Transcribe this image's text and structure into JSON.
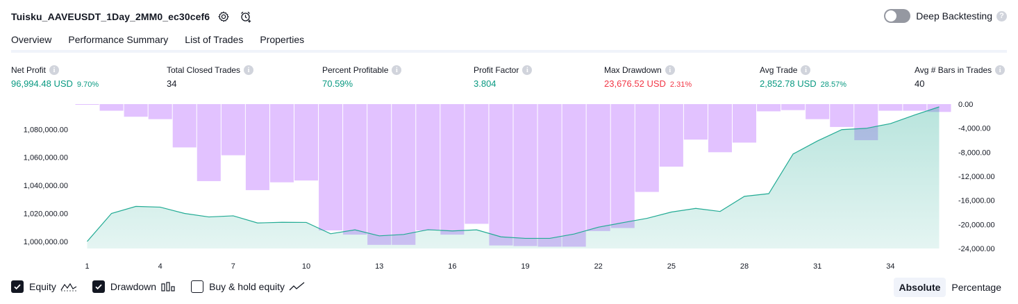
{
  "header": {
    "title": "Tuisku_AAVEUSDT_1Day_2MM0_ec30cef6",
    "settings_icon": "gear-icon",
    "alert_icon": "alarm-clock-plus-icon",
    "deep_backtesting_label": "Deep Backtesting",
    "deep_backtesting_enabled": false,
    "help_glyph": "?"
  },
  "tabs": [
    {
      "label": "Overview",
      "active": true
    },
    {
      "label": "Performance Summary",
      "active": false
    },
    {
      "label": "List of Trades",
      "active": false
    },
    {
      "label": "Properties",
      "active": false
    }
  ],
  "info_glyph": "i",
  "metrics": [
    {
      "label": "Net Profit",
      "value": "96,994.48 USD",
      "percent": "9.70%",
      "tone": "pos"
    },
    {
      "label": "Total Closed Trades",
      "value": "34",
      "percent": "",
      "tone": "neu"
    },
    {
      "label": "Percent Profitable",
      "value": "70.59%",
      "percent": "",
      "tone": "pos"
    },
    {
      "label": "Profit Factor",
      "value": "3.804",
      "percent": "",
      "tone": "pos"
    },
    {
      "label": "Max Drawdown",
      "value": "23,676.52 USD",
      "percent": "2.31%",
      "tone": "neg"
    },
    {
      "label": "Avg Trade",
      "value": "2,852.78 USD",
      "percent": "28.57%",
      "tone": "pos"
    },
    {
      "label": "Avg # Bars in Trades",
      "value": "40",
      "percent": "",
      "tone": "neu"
    }
  ],
  "colors": {
    "positive": "#089981",
    "negative": "#f23645",
    "equity_line": "#22ab94",
    "equity_fill": "#cbeee6",
    "drawdown_bar": "#e2c2ff",
    "drawdown_overlap": "#b7b2ea"
  },
  "chart_data": {
    "type": "area+bar",
    "x_ticks": [
      "1",
      "4",
      "7",
      "10",
      "13",
      "16",
      "19",
      "22",
      "25",
      "28",
      "31",
      "34"
    ],
    "left_axis_ticks": [
      "1,080,000.00",
      "1,060,000.00",
      "1,040,000.00",
      "1,020,000.00",
      "1,000,000.00"
    ],
    "right_axis_ticks": [
      "0.00",
      "-4,000.00",
      "-8,000.00",
      "-12,000.00",
      "-16,000.00",
      "-20,000.00",
      "-24,000.00"
    ],
    "equity_ylim": [
      995000,
      1096000
    ],
    "drawdown_ylim": [
      -24000,
      0
    ],
    "series": [
      {
        "name": "Equity",
        "x": [
          1,
          2,
          3,
          4,
          5,
          6,
          7,
          8,
          9,
          10,
          11,
          12,
          13,
          14,
          15,
          16,
          17,
          18,
          19,
          20,
          21,
          22,
          23,
          24,
          25,
          26,
          27,
          28,
          29,
          30,
          31,
          32,
          33,
          34,
          35,
          36
        ],
        "values": [
          1000000,
          1020000,
          1025000,
          1024500,
          1020000,
          1017500,
          1018300,
          1013200,
          1013700,
          1013600,
          1005500,
          1008300,
          1004000,
          1005000,
          1008400,
          1007500,
          1008300,
          1003300,
          1002200,
          1002200,
          1005300,
          1010200,
          1013400,
          1016500,
          1021000,
          1023600,
          1021400,
          1032200,
          1034100,
          1062400,
          1071700,
          1079800,
          1080700,
          1084100,
          1090300,
          1096000
        ]
      },
      {
        "name": "Drawdown",
        "x": [
          1,
          2,
          3,
          4,
          5,
          6,
          7,
          8,
          9,
          10,
          11,
          12,
          13,
          14,
          15,
          16,
          17,
          18,
          19,
          20,
          21,
          22,
          23,
          24,
          25,
          26,
          27,
          28,
          29,
          30,
          31,
          32,
          33,
          34,
          35,
          36
        ],
        "values": [
          -100,
          -1100,
          -2100,
          -2500,
          -7200,
          -12800,
          -8500,
          -14300,
          -13000,
          -12700,
          -21000,
          -21700,
          -23400,
          -23400,
          -21000,
          -21700,
          -19900,
          -23500,
          -23600,
          -23700,
          -23700,
          -21100,
          -20600,
          -14600,
          -10400,
          -5900,
          -8000,
          -6400,
          -1200,
          -1000,
          -2500,
          -3800,
          -6000,
          -1100,
          -1100,
          -1300
        ]
      }
    ]
  },
  "legend": [
    {
      "label": "Equity",
      "checked": true,
      "icon": "equity-line-icon"
    },
    {
      "label": "Drawdown",
      "checked": true,
      "icon": "drawdown-bars-icon"
    },
    {
      "label": "Buy & hold equity",
      "checked": false,
      "icon": "buy-hold-line-icon"
    }
  ],
  "scale_toggle": {
    "options": [
      "Absolute",
      "Percentage"
    ],
    "selected": "Absolute"
  }
}
